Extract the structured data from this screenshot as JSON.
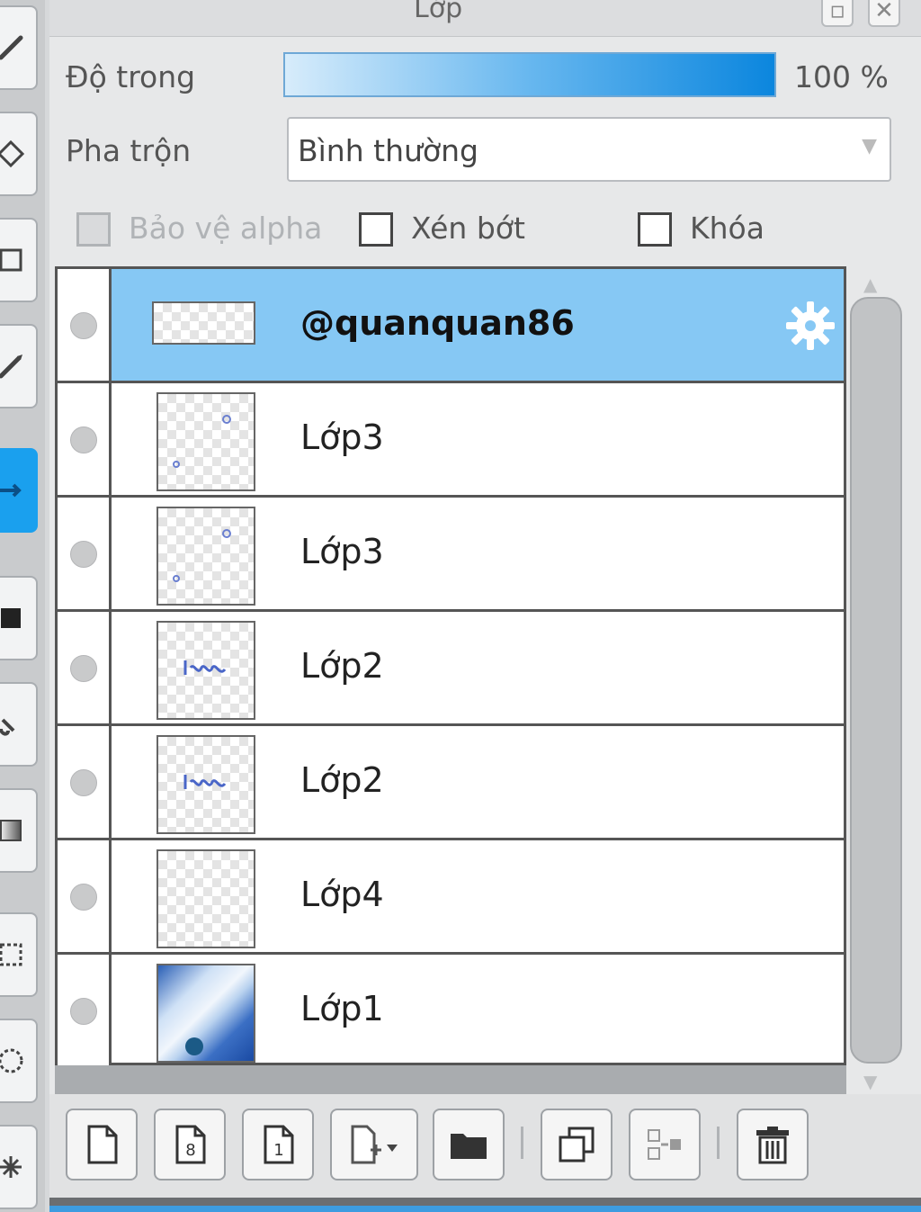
{
  "panel": {
    "title": "Lớp",
    "opacity_label": "Độ trong",
    "opacity_value": "100 %",
    "opacity_level": 1.0,
    "blend_label": "Pha trộn",
    "blend_value": "Bình thường",
    "options": {
      "alpha_protect": "Bảo vệ alpha",
      "clipping": "Xén bớt",
      "lock": "Khóa"
    }
  },
  "layers": [
    {
      "name": "@quanquan86",
      "selected": true,
      "thumb": "text-wide"
    },
    {
      "name": "Lớp3",
      "selected": false,
      "thumb": "dots"
    },
    {
      "name": "Lớp3",
      "selected": false,
      "thumb": "dots"
    },
    {
      "name": "Lớp2",
      "selected": false,
      "thumb": "scribble"
    },
    {
      "name": "Lớp2",
      "selected": false,
      "thumb": "scribble"
    },
    {
      "name": "Lớp4",
      "selected": false,
      "thumb": "empty"
    },
    {
      "name": "Lớp1",
      "selected": false,
      "thumb": "photo"
    }
  ],
  "toolbar": {
    "icons": [
      "new-layer-icon",
      "new-8bit-layer-icon",
      "new-1bit-layer-icon",
      "add-layer-dropdown-icon",
      "folder-icon",
      "duplicate-layer-icon",
      "merge-down-icon",
      "trash-icon"
    ],
    "thumb_text_8": "8",
    "thumb_text_1": "1"
  },
  "colors": {
    "accent": "#1aa0ee",
    "selected_row": "#86c8f4",
    "opacity_gradient_end": "#0b86de"
  }
}
